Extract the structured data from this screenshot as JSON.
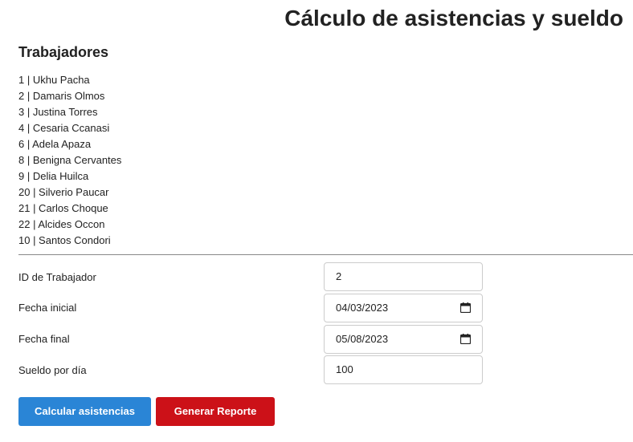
{
  "header": {
    "title": "Cálculo de asistencias y sueldo"
  },
  "workers": {
    "heading": "Trabajadores",
    "items": [
      "1 | Ukhu Pacha",
      "2 | Damaris Olmos",
      "3 | Justina Torres",
      "4 | Cesaria Ccanasi",
      "6 | Adela Apaza",
      "8 | Benigna Cervantes",
      "9 | Delia Huilca",
      "20 | Silverio Paucar",
      "21 | Carlos Choque",
      "22 | Alcides Occon",
      "10 | Santos Condori"
    ]
  },
  "form": {
    "worker_id": {
      "label": "ID de Trabajador",
      "value": "2"
    },
    "start_date": {
      "label": "Fecha inicial",
      "value": "04/03/2023"
    },
    "end_date": {
      "label": "Fecha final",
      "value": "05/08/2023"
    },
    "daily_wage": {
      "label": "Sueldo por día",
      "value": "100"
    }
  },
  "actions": {
    "calculate_label": "Calcular asistencias",
    "report_label": "Generar Reporte"
  },
  "colors": {
    "calculate_button": "#2a85d6",
    "report_button": "#cc1118"
  }
}
